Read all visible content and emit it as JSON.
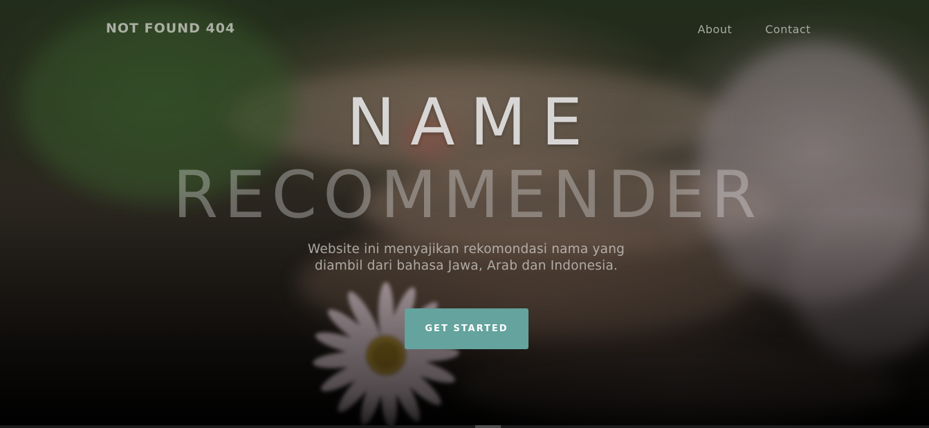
{
  "brand": "NOT FOUND 404",
  "nav": {
    "items": [
      {
        "label": "About"
      },
      {
        "label": "Contact"
      }
    ]
  },
  "hero": {
    "title_line1": "NAME",
    "title_line2": "RECOMMENDER",
    "subtitle_line1": "Website ini menyajikan rekomondasi nama yang",
    "subtitle_line2": "diambil dari bahasa Jawa, Arab dan Indonesia.",
    "cta_label": "GET STARTED"
  },
  "colors": {
    "accent": "#64a39e",
    "background_dark": "#0b0a08"
  },
  "icons": {
    "background_image": "blurred-hand-daisy-photo"
  }
}
